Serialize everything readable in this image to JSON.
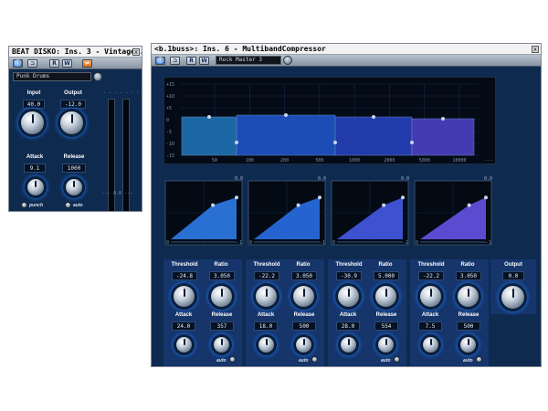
{
  "vintage": {
    "title": "BEAT DISKO: Ins. 3 - Vintage...",
    "close": "x",
    "toolbar": {
      "power": "ⓘ",
      "bypass": "⊐",
      "read": "R",
      "write": "W",
      "extra": "⇌"
    },
    "preset": "Punk Drums",
    "input_label": "Input",
    "output_label": "Output",
    "input_value": "40.0",
    "output_value": "-12.0",
    "attack_label": "Attack",
    "release_label": "Release",
    "attack_value": "9.1",
    "release_value": "1000",
    "punch_label": "punch",
    "auto_label": "auto",
    "meter_scale_top": "- - -  - -  - - -",
    "meter_scale_bottom": "---  0.0  ---"
  },
  "multiband": {
    "title": "<b.1buss>: Ins. 6 - MultibandCompressor",
    "close": "x",
    "toolbar": {
      "power": "ⓘ",
      "bypass": "⊐",
      "read": "R",
      "write": "W"
    },
    "preset": "Rock Master 3",
    "graph": {
      "y_ticks": [
        "+15",
        "+10",
        "+5",
        "0",
        "-5",
        "-10",
        "-15"
      ],
      "x_ticks": [
        "50",
        "100",
        "200",
        "500",
        "1000",
        "2000",
        "5000",
        "10000"
      ],
      "x_unit": "---",
      "bands": [
        {
          "color": "#1f6fb0"
        },
        {
          "color": "#1f52c4"
        },
        {
          "color": "#2440b8"
        },
        {
          "color": "#4a3fbf"
        }
      ]
    },
    "curves": [
      {
        "value": "0.0",
        "color": "#2a6fd2",
        "scale_left": "0",
        "scale_right": "-1"
      },
      {
        "value": "0.0",
        "color": "#2563d0",
        "scale_left": "0",
        "scale_right": "-1"
      },
      {
        "value": "0.0",
        "color": "#3d51d1",
        "scale_left": "0",
        "scale_right": "-1"
      },
      {
        "value": "0.0",
        "color": "#5a4bd0",
        "scale_left": "0",
        "scale_right": "-1"
      }
    ],
    "bands": [
      {
        "threshold_label": "Threshold",
        "ratio_label": "Ratio",
        "threshold": "-24.8",
        "ratio": "3.050",
        "attack_label": "Attack",
        "release_label": "Release",
        "attack": "24.0",
        "release": "357",
        "auto_label": "auto"
      },
      {
        "threshold_label": "Threshold",
        "ratio_label": "Ratio",
        "threshold": "-22.2",
        "ratio": "3.050",
        "attack_label": "Attack",
        "release_label": "Release",
        "attack": "18.0",
        "release": "500",
        "auto_label": "auto"
      },
      {
        "threshold_label": "Threshold",
        "ratio_label": "Ratio",
        "threshold": "-30.9",
        "ratio": "5.000",
        "attack_label": "Attack",
        "release_label": "Release",
        "attack": "28.0",
        "release": "554",
        "auto_label": "auto"
      },
      {
        "threshold_label": "Threshold",
        "ratio_label": "Ratio",
        "threshold": "-22.2",
        "ratio": "3.050",
        "attack_label": "Attack",
        "release_label": "Release",
        "attack": "7.5",
        "release": "500",
        "auto_label": "auto"
      }
    ],
    "output_label": "Output",
    "output_value": "0.0"
  }
}
